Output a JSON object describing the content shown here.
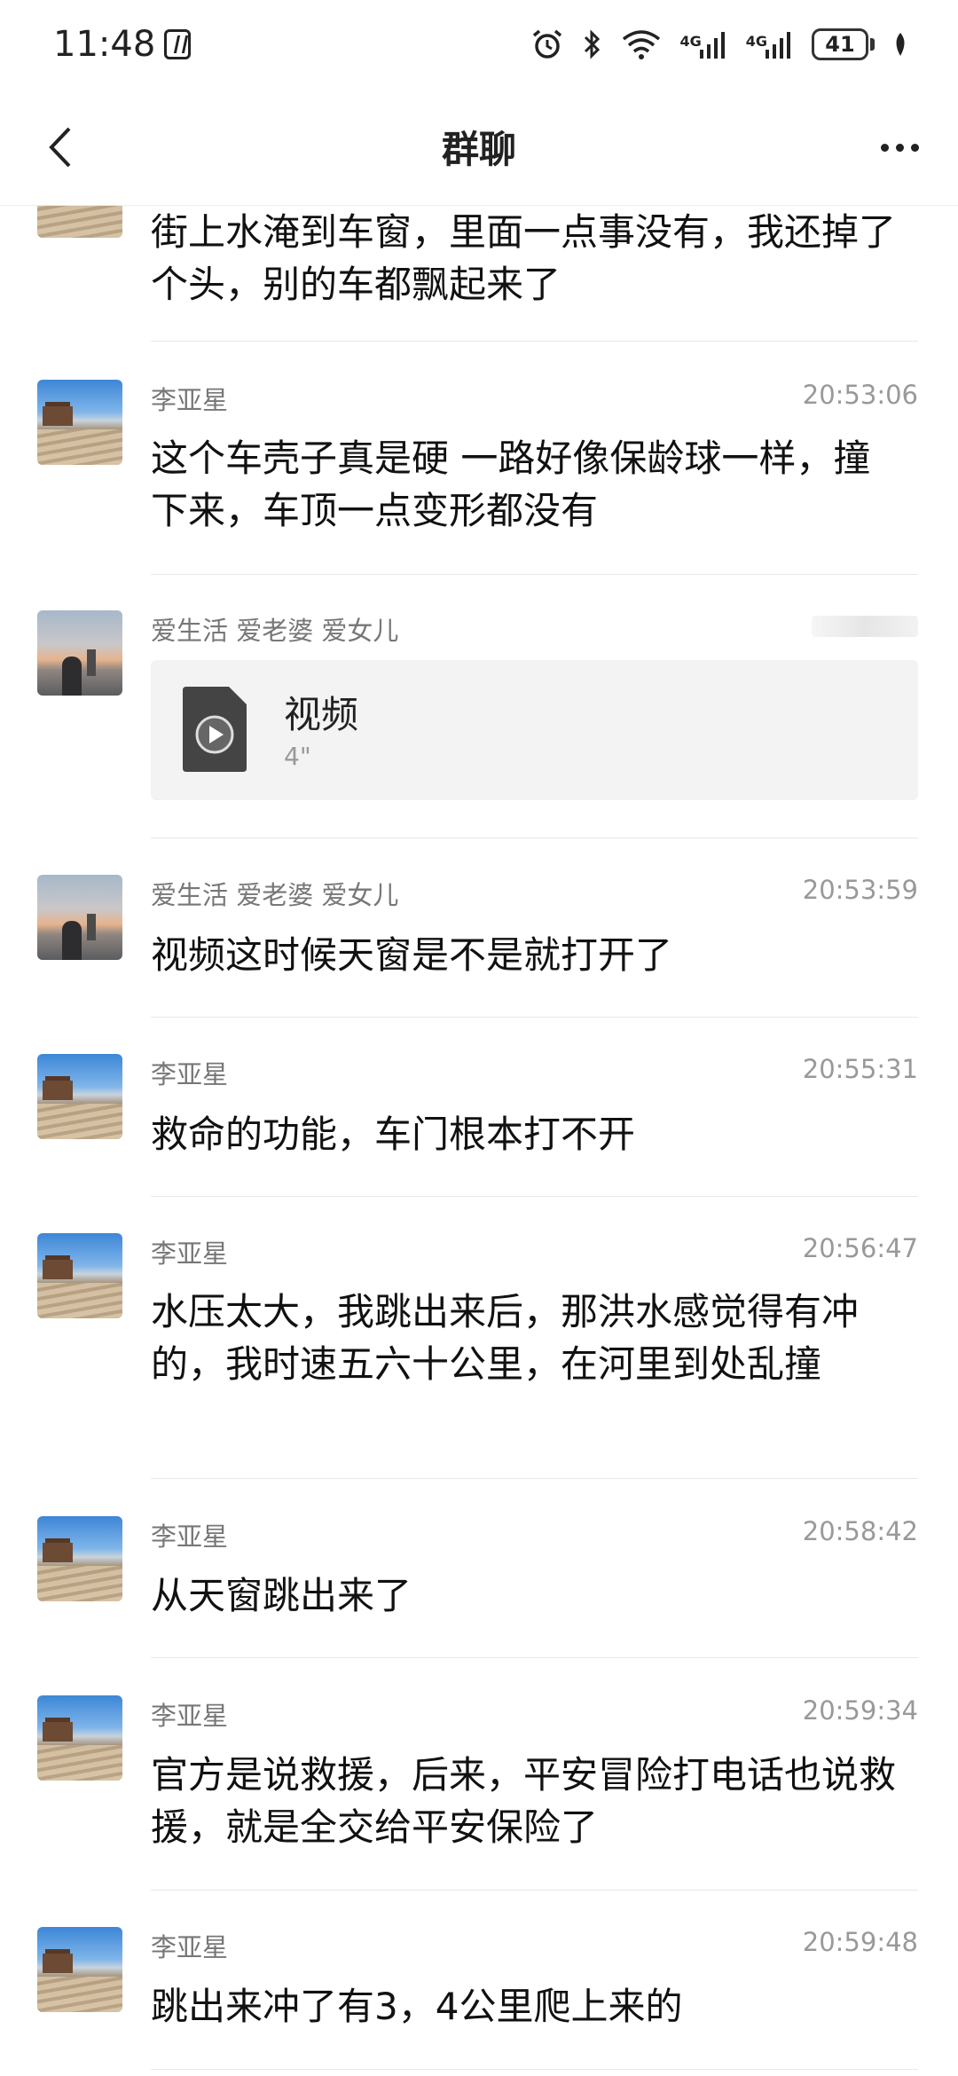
{
  "status_bar": {
    "time": "11:48",
    "signal_1_label": "4G",
    "signal_2_label": "4G",
    "battery": "41"
  },
  "header": {
    "title": "群聊"
  },
  "messages": [
    {
      "text": "街上水淹到车窗，里面一点事没有，我还掉了个头，别的车都飘起来了"
    },
    {
      "sender": "李亚星",
      "time": "20:53:06",
      "text": "这个车壳子真是硬 一路好像保龄球一样，撞下来，车顶一点变形都没有"
    },
    {
      "sender": "爱生活 爱老婆  爱女儿",
      "video_title": "视频",
      "video_duration": "4\""
    },
    {
      "sender": "爱生活 爱老婆  爱女儿",
      "time": "20:53:59",
      "text": "视频这时候天窗是不是就打开了"
    },
    {
      "sender": "李亚星",
      "time": "20:55:31",
      "text": "救命的功能，车门根本打不开"
    },
    {
      "sender": "李亚星",
      "time": "20:56:47",
      "text": "水压太大，我跳出来后，那洪水感觉得有冲的，我时速五六十公里，在河里到处乱撞"
    },
    {
      "sender": "李亚星",
      "time": "20:58:42",
      "text": "从天窗跳出来了"
    },
    {
      "sender": "李亚星",
      "time": "20:59:34",
      "text": "官方是说救援，后来，平安冒险打电话也说救援，就是全交给平安保险了"
    },
    {
      "sender": "李亚星",
      "time": "20:59:48",
      "text": "跳出来冲了有3，4公里爬上来的"
    }
  ],
  "icons": {
    "alarm": "alarm-icon",
    "bluetooth": "bluetooth-icon",
    "wifi": "wifi-icon",
    "back": "chevron-left-icon",
    "more": "more-dots-icon",
    "video": "video-file-icon"
  }
}
